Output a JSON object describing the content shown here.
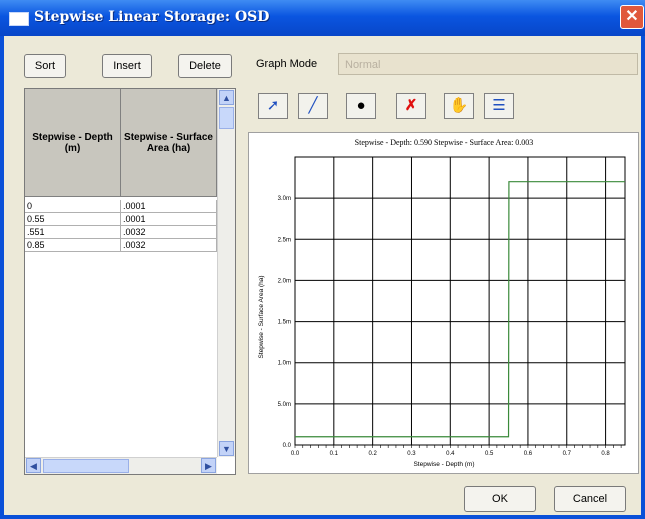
{
  "window": {
    "title": "Stepwise Linear Storage: OSD",
    "close_glyph": "✕"
  },
  "toolbar": {
    "sort_label": "Sort",
    "insert_label": "Insert",
    "delete_label": "Delete",
    "graph_mode_label": "Graph Mode",
    "graph_mode_value": "Normal"
  },
  "table": {
    "columns": [
      "Stepwise - Depth (m)",
      "Stepwise - Surface Area (ha)"
    ],
    "rows": [
      [
        "0",
        ".0001"
      ],
      [
        "0.55",
        ".0001"
      ],
      [
        ".551",
        ".0032"
      ],
      [
        "0.85",
        ".0032"
      ]
    ]
  },
  "graph_tools": [
    {
      "name": "select-arrow-icon",
      "glyph": "➚"
    },
    {
      "name": "draw-line-icon",
      "glyph": "╱"
    },
    {
      "name": "add-point-icon",
      "glyph": "●"
    },
    {
      "name": "delete-point-icon",
      "glyph": "✗"
    },
    {
      "name": "pan-hand-icon",
      "glyph": "✋"
    },
    {
      "name": "list-icon",
      "glyph": "☰"
    }
  ],
  "chart_data": {
    "type": "line",
    "title": "Stepwise - Depth: 0.590 Stepwise - Surface Area: 0.003",
    "xlabel": "Stepwise - Depth (m)",
    "ylabel": "Stepwise - Surface Area (ha)",
    "xlim": [
      0,
      0.85
    ],
    "ylim": [
      0,
      0.0035
    ],
    "x_ticks": [
      "0.0",
      "0.1",
      "0.2",
      "0.3",
      "0.4",
      "0.5",
      "0.6",
      "0.7",
      "0.8"
    ],
    "y_ticks": [
      "0.0",
      "5.0m",
      "1.0m",
      "1.5m",
      "2.0m",
      "2.5m",
      "3.0m"
    ],
    "grid": true,
    "series": [
      {
        "x": [
          0,
          0.55,
          0.551,
          0.85
        ],
        "y": [
          0.0001,
          0.0001,
          0.0032,
          0.0032
        ],
        "color": "#3a8a3a"
      }
    ]
  },
  "footer": {
    "ok_label": "OK",
    "cancel_label": "Cancel"
  }
}
